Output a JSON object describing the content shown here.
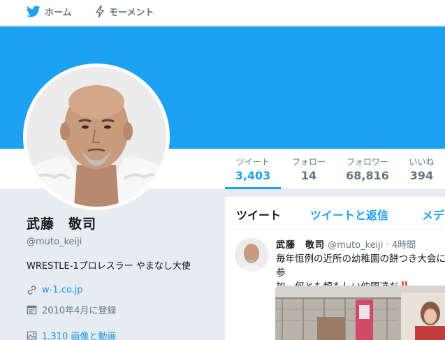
{
  "nav": {
    "home_label": "ホーム",
    "moments_label": "モーメント"
  },
  "profile": {
    "name": "武藤　敬司",
    "handle": "@muto_keiji",
    "bio": "WRESTLE-1プロレスラー やまなし大使",
    "url": "w-1.co.jp",
    "joined": "2010年4月に登録",
    "media": "1,310 画像と動画"
  },
  "stats": [
    {
      "label": "ツイート",
      "value": "3,403"
    },
    {
      "label": "フォロー",
      "value": "14"
    },
    {
      "label": "フォロワー",
      "value": "68,816"
    },
    {
      "label": "いいね",
      "value": "394"
    }
  ],
  "timeline": {
    "tabs": [
      "ツイート",
      "ツイートと返信",
      "メディア"
    ],
    "tweet": {
      "name": "武藤　敬司",
      "handle": "@muto_keiji",
      "separator": "·",
      "time": "4時間",
      "text_line1": "毎年恒例の近所の幼稚園の餅つき大会に参",
      "text_line2": "加。何とも頼もしい仲間達だ",
      "emoji": "‼️"
    }
  },
  "colors": {
    "brand": "#1da1f2",
    "link": "#1b95e0",
    "background": "#e6ecf0"
  }
}
